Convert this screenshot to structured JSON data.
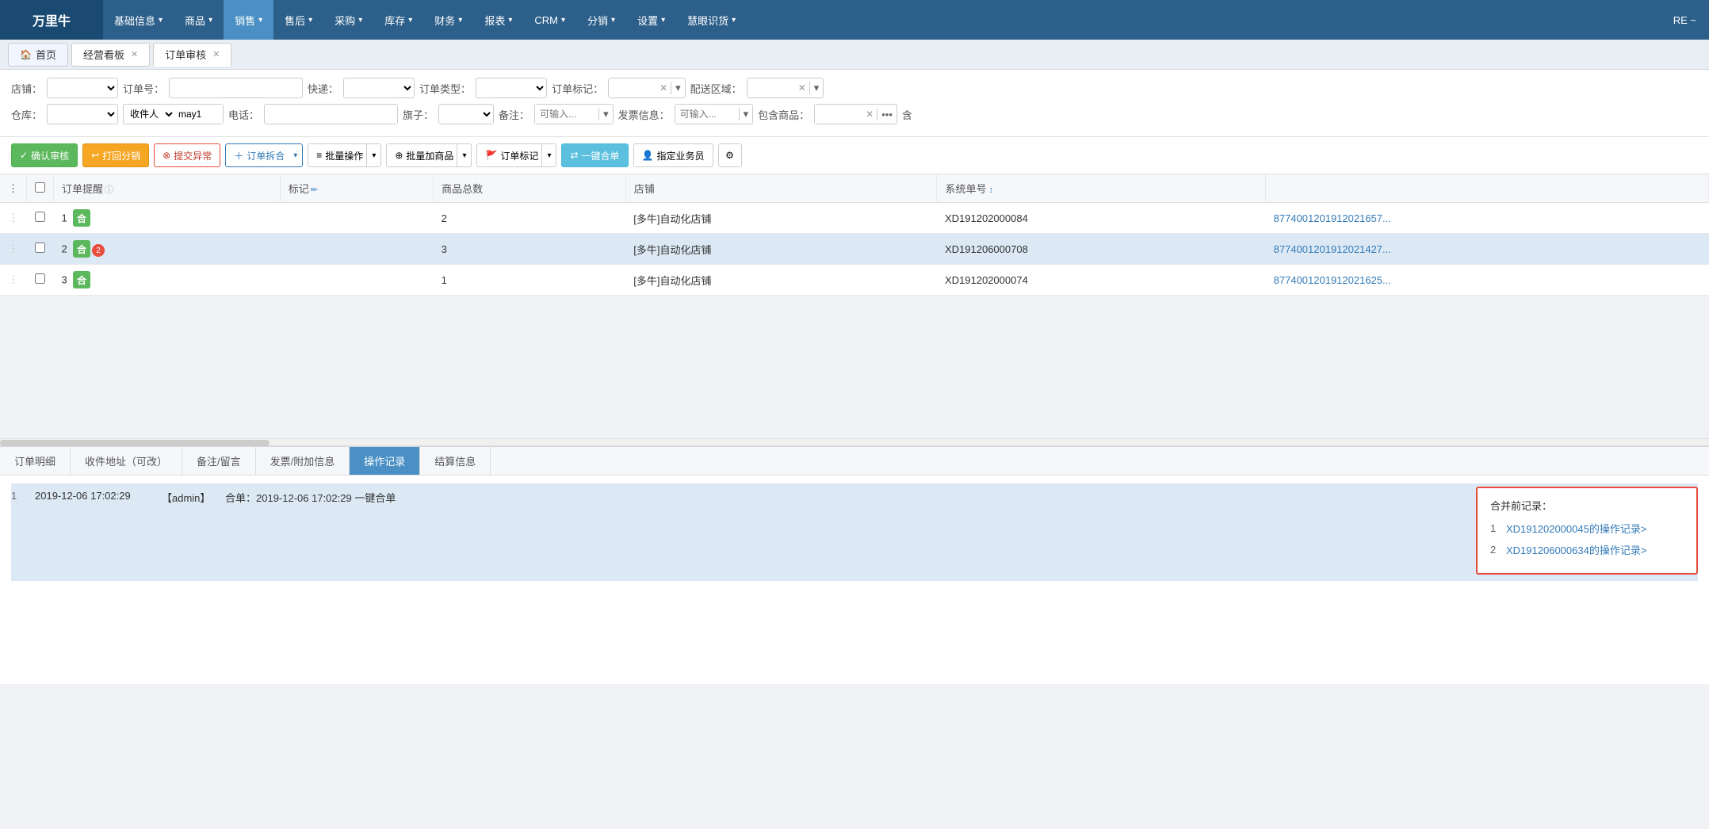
{
  "nav": {
    "logo": "万里牛",
    "items": [
      {
        "label": "基础信息",
        "has_arrow": true,
        "active": false
      },
      {
        "label": "商品",
        "has_arrow": true,
        "active": false
      },
      {
        "label": "销售",
        "has_arrow": true,
        "active": true
      },
      {
        "label": "售后",
        "has_arrow": true,
        "active": false
      },
      {
        "label": "采购",
        "has_arrow": true,
        "active": false
      },
      {
        "label": "库存",
        "has_arrow": true,
        "active": false
      },
      {
        "label": "财务",
        "has_arrow": true,
        "active": false
      },
      {
        "label": "报表",
        "has_arrow": true,
        "active": false
      },
      {
        "label": "CRM",
        "has_arrow": true,
        "active": false
      },
      {
        "label": "分销",
        "has_arrow": true,
        "active": false
      },
      {
        "label": "设置",
        "has_arrow": true,
        "active": false
      },
      {
        "label": "慧眼识货",
        "has_arrow": true,
        "active": false
      }
    ],
    "right_text": "RE ~"
  },
  "tabs": [
    {
      "label": "首页",
      "icon": "🏠",
      "closable": false,
      "active": false
    },
    {
      "label": "经营看板",
      "icon": "",
      "closable": true,
      "active": false
    },
    {
      "label": "订单审核",
      "icon": "",
      "closable": true,
      "active": true
    }
  ],
  "filters": {
    "row1": [
      {
        "label": "店铺：",
        "type": "select",
        "value": "",
        "placeholder": ""
      },
      {
        "label": "订单号：",
        "type": "input",
        "value": "",
        "placeholder": ""
      },
      {
        "label": "快递：",
        "type": "select",
        "value": "",
        "placeholder": ""
      },
      {
        "label": "订单类型：",
        "type": "select",
        "value": "",
        "placeholder": ""
      },
      {
        "label": "订单标记：",
        "type": "select-x",
        "value": ""
      },
      {
        "label": "配送区域：",
        "type": "select-x",
        "value": ""
      }
    ],
    "row2": [
      {
        "label": "仓库：",
        "type": "select",
        "value": "",
        "placeholder": ""
      },
      {
        "label": "收件人",
        "type": "select-input",
        "select_value": "收件人",
        "value": "may1"
      },
      {
        "label": "电话：",
        "type": "input",
        "value": "",
        "placeholder": ""
      },
      {
        "label": "旗子：",
        "type": "select",
        "value": "",
        "placeholder": ""
      },
      {
        "label": "备注：",
        "type": "select-input2",
        "placeholder": "可输入..."
      },
      {
        "label": "发票信息：",
        "type": "select-input2",
        "placeholder": "可输入..."
      },
      {
        "label": "包含商品：",
        "type": "select-x-dots",
        "value": ""
      }
    ]
  },
  "toolbar": {
    "buttons": [
      {
        "label": "确认审核",
        "type": "green",
        "icon": "✓"
      },
      {
        "label": "打回分销",
        "type": "orange",
        "icon": "↩"
      },
      {
        "label": "提交异常",
        "type": "red-outline",
        "icon": "⊗"
      },
      {
        "label": "订单拆合",
        "type": "dropdown",
        "icon": "＋"
      },
      {
        "label": "批量操作",
        "type": "dropdown",
        "icon": "≡"
      },
      {
        "label": "批量加商品",
        "type": "dropdown",
        "icon": "⊕"
      },
      {
        "label": "订单标记",
        "type": "dropdown",
        "icon": "🚩"
      },
      {
        "label": "一键合单",
        "type": "teal",
        "icon": "⇄"
      },
      {
        "label": "指定业务员",
        "type": "default",
        "icon": "👤"
      },
      {
        "label": "⚙",
        "type": "settings"
      }
    ]
  },
  "table": {
    "headers": [
      {
        "label": "",
        "type": "drag"
      },
      {
        "label": "",
        "type": "checkbox"
      },
      {
        "label": "订单提醒",
        "info": true
      },
      {
        "label": "标记",
        "edit": true
      },
      {
        "label": "商品总数"
      },
      {
        "label": "店铺"
      },
      {
        "label": "系统单号",
        "sort": true
      },
      {
        "label": ""
      }
    ],
    "rows": [
      {
        "num": "1",
        "checked": false,
        "tags": [
          {
            "color": "green",
            "text": "合",
            "badge": null
          }
        ],
        "mark": "",
        "goods_count": "2",
        "store": "[多牛]自动化店铺",
        "sys_no": "XD191202000084",
        "link": "8774001201912021657..."
      },
      {
        "num": "2",
        "checked": false,
        "tags": [
          {
            "color": "green",
            "text": "合",
            "badge": "2"
          }
        ],
        "mark": "",
        "goods_count": "3",
        "store": "[多牛]自动化店铺",
        "sys_no": "XD191206000708",
        "link": "8774001201912021427..."
      },
      {
        "num": "3",
        "checked": false,
        "tags": [
          {
            "color": "green",
            "text": "合",
            "badge": null
          }
        ],
        "mark": "",
        "goods_count": "1",
        "store": "[多牛]自动化店铺",
        "sys_no": "XD191202000074",
        "link": "8774001201912021625..."
      }
    ]
  },
  "bottom_tabs": [
    {
      "label": "订单明细",
      "active": false
    },
    {
      "label": "收件地址（可改）",
      "active": false
    },
    {
      "label": "备注/留言",
      "active": false
    },
    {
      "label": "发票/附加信息",
      "active": false
    },
    {
      "label": "操作记录",
      "active": true
    },
    {
      "label": "结算信息",
      "active": false
    }
  ],
  "operation_records": [
    {
      "num": "1",
      "datetime": "2019-12-06 17:02:29",
      "user": "【admin】",
      "content": "合单：2019-12-06 17:02:29 一键合单"
    }
  ],
  "merge_records": {
    "title": "合并前记录：",
    "items": [
      {
        "num": "1",
        "text": "XD191202000045的操作记录>"
      },
      {
        "num": "2",
        "text": "XD191206000634的操作记录>"
      }
    ]
  }
}
